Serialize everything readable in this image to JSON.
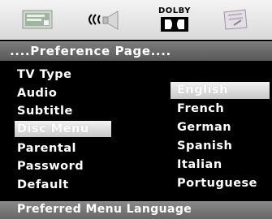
{
  "toolbar": {
    "icons": [
      "general-setup-icon",
      "audio-setup-icon",
      "dolby-digital-icon",
      "preference-icon"
    ],
    "dolby_label": "DOLBY"
  },
  "title": "....Preference Page....",
  "menu": {
    "items": [
      {
        "label": "TV Type"
      },
      {
        "label": "Audio"
      },
      {
        "label": "Subtitle"
      },
      {
        "label": "Disc Menu"
      },
      {
        "label": "Parental"
      },
      {
        "label": "Password"
      },
      {
        "label": "Default"
      }
    ],
    "selected": "Disc Menu"
  },
  "options": {
    "items": [
      {
        "label": "English"
      },
      {
        "label": "French"
      },
      {
        "label": "German"
      },
      {
        "label": "Spanish"
      },
      {
        "label": "Italian"
      },
      {
        "label": "Portuguese"
      }
    ],
    "selected": "English"
  },
  "status": "Preferred Menu Language",
  "colors": {
    "background": "#000000",
    "bar": "#6a6a6a",
    "highlight": "#dcdcdc",
    "text": "#ffffff"
  }
}
